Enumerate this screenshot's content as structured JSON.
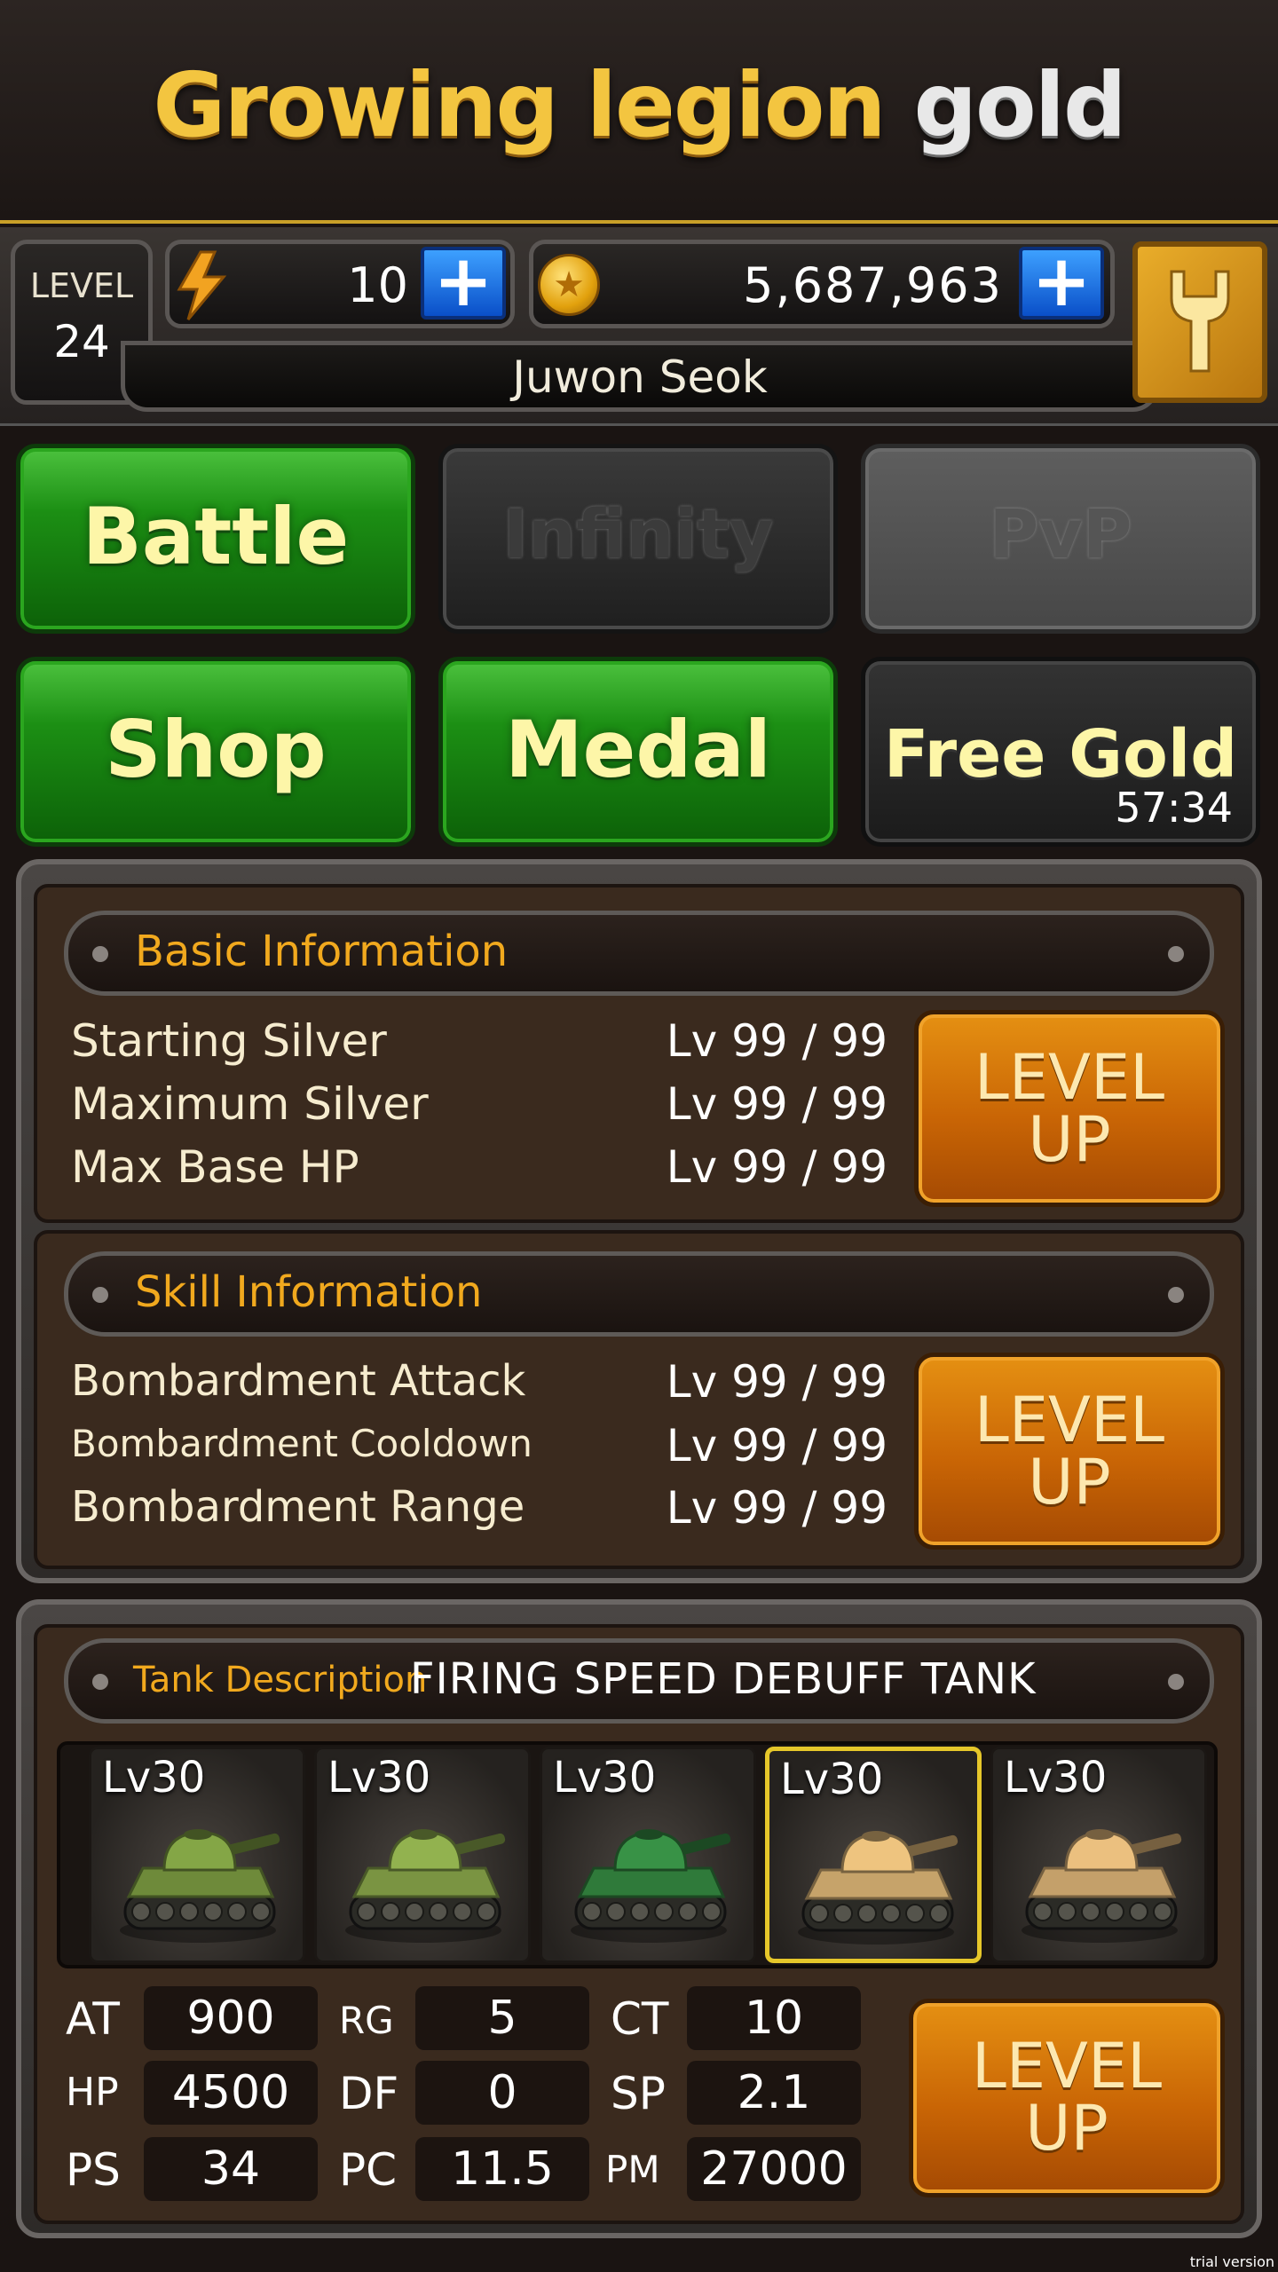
{
  "header": {
    "title_main": "Growing legion",
    "title_accent": "gold"
  },
  "status": {
    "level_label": "LEVEL",
    "level_value": "24",
    "energy_value": "10",
    "gold_value": "5,687,963",
    "player_name": "Juwon Seok",
    "icons": {
      "energy": "lightning-bolt-icon",
      "gold": "gold-coin-icon",
      "settings": "wrench-icon",
      "add": "plus-icon"
    },
    "colors": {
      "accent_gold": "#c9a028",
      "plus_blue": "#1a6fe0"
    }
  },
  "menu": {
    "battle": "Battle",
    "infinity": "Infinity",
    "pvp": "PvP",
    "shop": "Shop",
    "medal": "Medal",
    "free_gold": "Free Gold",
    "free_gold_timer": "57:34"
  },
  "basic_info": {
    "title": "Basic Information",
    "rows": [
      {
        "label": "Starting Silver",
        "value": "Lv 99 / 99"
      },
      {
        "label": "Maximum Silver",
        "value": "Lv 99 / 99"
      },
      {
        "label": "Max Base HP",
        "value": "Lv 99 / 99"
      }
    ],
    "button_line1": "LEVEL",
    "button_line2": "UP"
  },
  "skill_info": {
    "title": "Skill Information",
    "rows": [
      {
        "label": "Bombardment Attack",
        "value": "Lv 99 / 99"
      },
      {
        "label": "Bombardment Cooldown",
        "value": "Lv 99 / 99"
      },
      {
        "label": "Bombardment Range",
        "value": "Lv 99 / 99"
      }
    ],
    "button_line1": "LEVEL",
    "button_line2": "UP"
  },
  "tank": {
    "description_label": "Tank Description",
    "description_value": "FIRING SPEED DEBUFF TANK",
    "cards": [
      {
        "level": "Lv30",
        "color": "#6e8a3a",
        "selected": false
      },
      {
        "level": "Lv30",
        "color": "#7a9442",
        "selected": false
      },
      {
        "level": "Lv30",
        "color": "#2f7a3a",
        "selected": false
      },
      {
        "level": "Lv30",
        "color": "#c6a36a",
        "selected": true
      },
      {
        "level": "Lv30",
        "color": "#c4a06a",
        "selected": false
      }
    ],
    "stats": {
      "AT": {
        "label": "AT",
        "value": "900"
      },
      "RG": {
        "label": "RG",
        "value": "5"
      },
      "CT": {
        "label": "CT",
        "value": "10"
      },
      "HP": {
        "label": "HP",
        "value": "4500"
      },
      "DF": {
        "label": "DF",
        "value": "0"
      },
      "SP": {
        "label": "SP",
        "value": "2.1"
      },
      "PS": {
        "label": "PS",
        "value": "34"
      },
      "PC": {
        "label": "PC",
        "value": "11.5"
      },
      "PM": {
        "label": "PM",
        "value": "27000"
      }
    },
    "button_line1": "LEVEL",
    "button_line2": "UP"
  },
  "watermark": "trial version"
}
